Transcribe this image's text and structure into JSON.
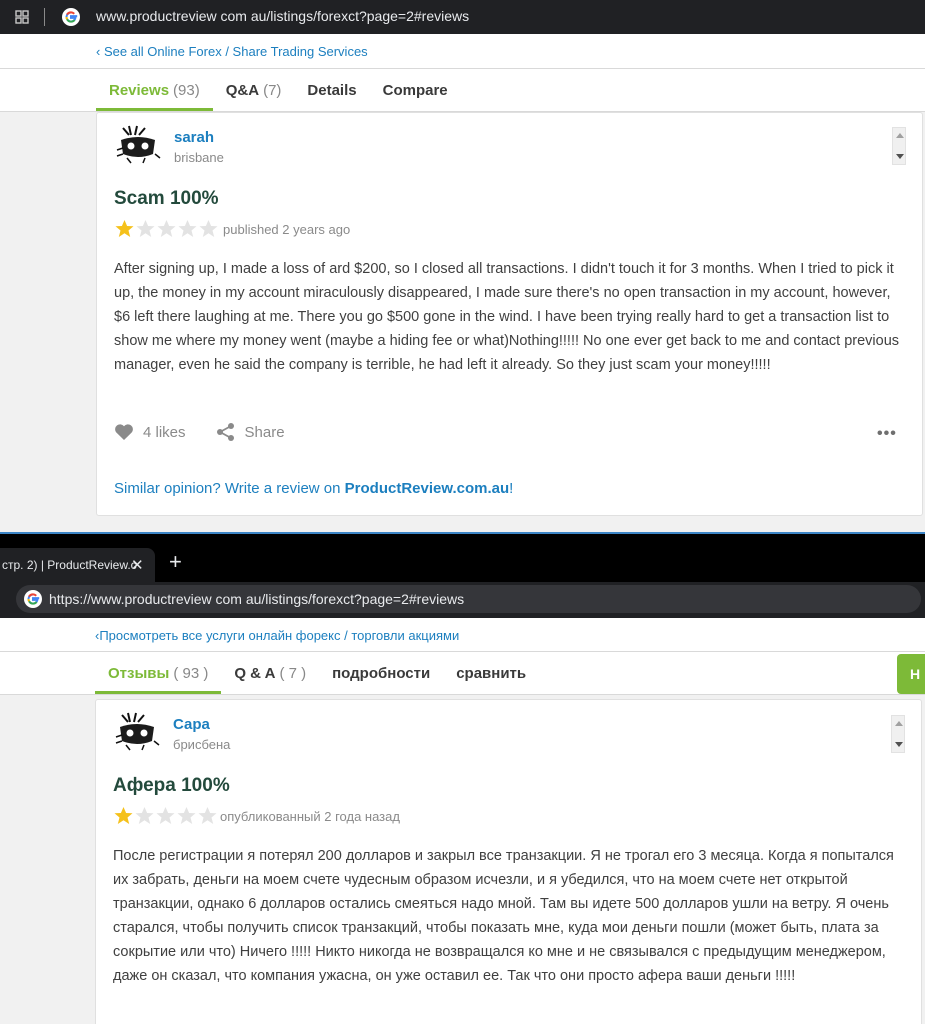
{
  "top_browser": {
    "url": "www.productreview com au/listings/forexct?page=2#reviews"
  },
  "en": {
    "breadcrumb": "‹ See all Online Forex / Share Trading Services",
    "tabs": [
      {
        "label": "Reviews",
        "count": "(93)"
      },
      {
        "label": "Q&A",
        "count": "(7)"
      },
      {
        "label": "Details",
        "count": ""
      },
      {
        "label": "Compare",
        "count": ""
      }
    ],
    "review": {
      "author": "sarah",
      "location": "brisbane",
      "title": "Scam 100%",
      "rating": 1,
      "rating_max": 5,
      "published": "published 2 years ago",
      "body": "After signing up, I made a loss of ard $200, so I closed all transactions. I didn't touch it for 3 months. When I tried to pick it up, the money in my account miraculously disappeared, I made sure there's no open transaction in my account, however, $6 left there laughing at me. There you go $500 gone in the wind. I have been trying really hard to get a transaction list to show me where my money went (maybe a hiding fee or what)Nothing!!!!! No one ever get back to me and contact previous manager, even he said the company is terrible, he had left it already. So they just scam your money!!!!!",
      "likes": "4 likes",
      "share": "Share",
      "more": "•••",
      "similar_prefix": "Similar opinion? Write a review on ",
      "similar_link": "ProductReview.com.au",
      "similar_suffix": "!"
    }
  },
  "second_browser": {
    "tab_title": "стр. 2) | ProductReview.c",
    "tab_close": "✕",
    "new_tab": "+",
    "url": "https://www.productreview com au/listings/forexct?page=2#reviews"
  },
  "ru": {
    "breadcrumb": "‹Просмотреть все услуги онлайн форекс / торговли акциями",
    "tabs": [
      {
        "label": "Отзывы",
        "count": "( 93 )"
      },
      {
        "label": "Q & A",
        "count": "( 7 )"
      },
      {
        "label": "подробности",
        "count": ""
      },
      {
        "label": "сравнить",
        "count": ""
      }
    ],
    "cta_partial": "Н",
    "review": {
      "author": "Сара",
      "location": "брисбена",
      "title": "Афера 100%",
      "rating": 1,
      "rating_max": 5,
      "published": "опубликованный 2 года назад",
      "body": "После регистрации я потерял 200 долларов и закрыл все транзакции. Я не трогал его 3 месяца. Когда я попытался их забрать, деньги на моем счете чудесным образом исчезли, и я убедился, что на моем счете нет открытой транзакции, однако 6 долларов остались смеяться надо мной. Там вы идете 500 долларов ушли на ветру. Я очень старался, чтобы получить список транзакций, чтобы показать мне, куда мои деньги пошли (может быть, плата за сокрытие или что) Ничего !!!!! Никто никогда не возвращался ко мне и не связывался с предыдущим менеджером, даже он сказал, что компания ужасна, он уже оставил ее. Так что они просто афера ваши деньги !!!!!"
    }
  },
  "colors": {
    "accent_green": "#7dba38",
    "link_blue": "#1c7fbf",
    "star_gold": "#f5c11b",
    "star_empty": "#e3e3e3",
    "browser_dark": "#202124"
  },
  "icons": [
    "apps-grid-icon",
    "google-g-icon",
    "heart-icon",
    "share-icon",
    "more-dots-icon",
    "chevron-up-icon",
    "chevron-down-icon",
    "close-icon",
    "plus-icon"
  ]
}
